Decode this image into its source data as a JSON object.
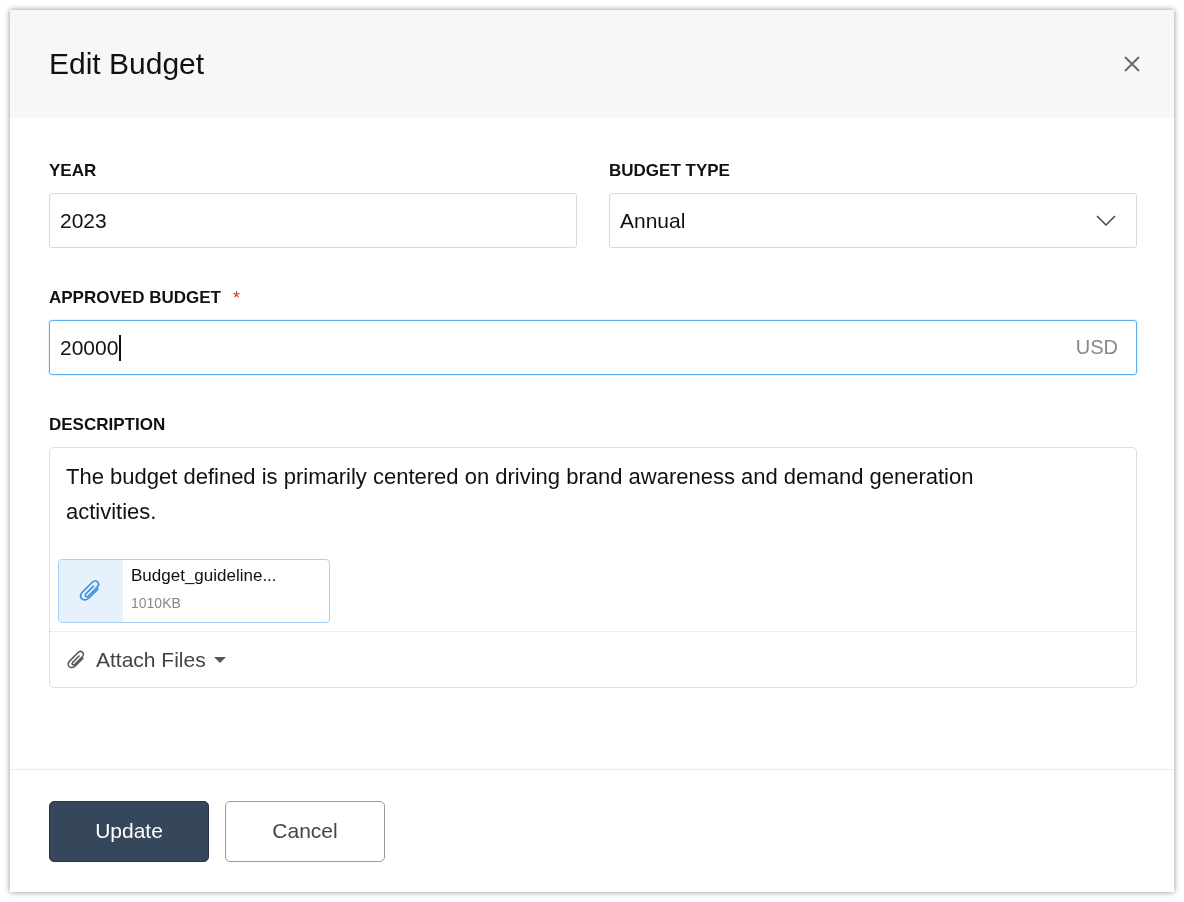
{
  "dialog": {
    "title": "Edit Budget"
  },
  "fields": [
    {
      "kind": "text",
      "label": "YEAR",
      "value": "2023",
      "focused": false
    },
    {
      "kind": "select",
      "label": "BUDGET TYPE",
      "value": "Annual",
      "focused": false
    },
    {
      "kind": "currency",
      "label": "APPROVED BUDGET",
      "required_mark": "*",
      "value": "20000",
      "suffix": "USD",
      "focused": true
    }
  ],
  "description": {
    "label": "DESCRIPTION",
    "text": "The budget defined is primarily centered on driving brand awareness and demand generation activities.",
    "attachments": [
      {
        "name": "Budget_guideline...",
        "size": "1010KB"
      }
    ],
    "attach_button": "Attach Files"
  },
  "buttons": [
    {
      "label": "Update",
      "kind": "primary"
    },
    {
      "label": "Cancel",
      "kind": "secondary"
    }
  ]
}
